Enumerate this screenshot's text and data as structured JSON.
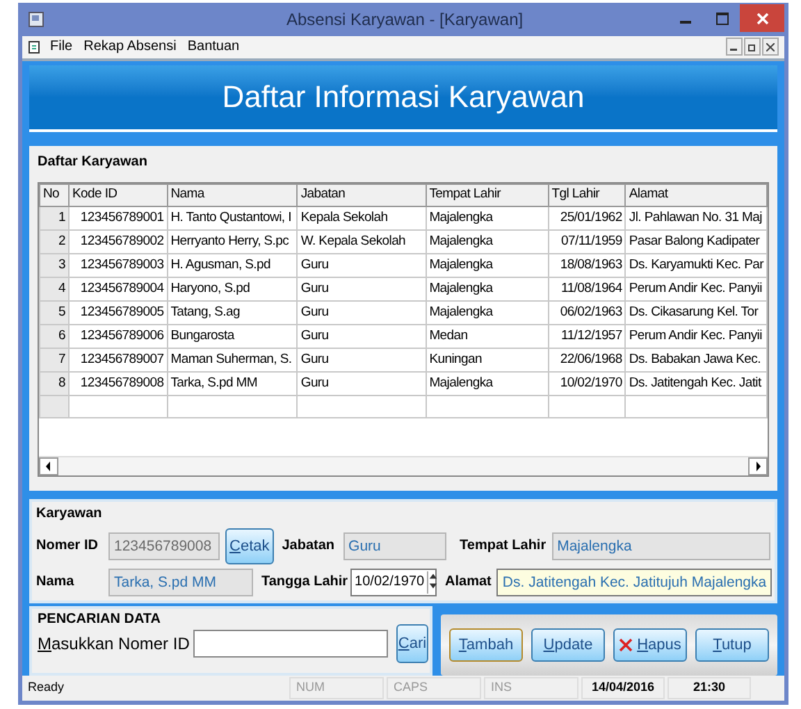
{
  "window": {
    "title": "Absensi Karyawan - [Karyawan]"
  },
  "menu": [
    "File",
    "Rekap Absensi",
    "Bantuan"
  ],
  "header": {
    "title": "Daftar Informasi Karyawan"
  },
  "list_group": {
    "title": "Daftar Karyawan"
  },
  "table": {
    "columns": [
      "No",
      "Kode ID",
      "Nama",
      "Jabatan",
      "Tempat Lahir",
      "Tgl Lahir",
      "Alamat"
    ],
    "rows": [
      [
        "1",
        "123456789001",
        "H. Tanto Qustantowi, I",
        "Kepala Sekolah",
        "Majalengka",
        "25/01/1962",
        "Jl. Pahlawan No. 31 Maj"
      ],
      [
        "2",
        "123456789002",
        "Herryanto Herry, S.pc",
        "W. Kepala Sekolah",
        "Majalengka",
        "07/11/1959",
        "Pasar Balong Kadipater"
      ],
      [
        "3",
        "123456789003",
        "H. Agusman, S.pd",
        "Guru",
        "Majalengka",
        "18/08/1963",
        "Ds. Karyamukti Kec. Par"
      ],
      [
        "4",
        "123456789004",
        "Haryono, S.pd",
        "Guru",
        "Majalengka",
        "11/08/1964",
        "Perum Andir Kec. Panyii"
      ],
      [
        "5",
        "123456789005",
        "Tatang, S.ag",
        "Guru",
        "Majalengka",
        "06/02/1963",
        "Ds. Cikasarung Kel. Tor"
      ],
      [
        "6",
        "123456789006",
        "Bungarosta",
        "Guru",
        "Medan",
        "11/12/1957",
        "Perum Andir Kec. Panyii"
      ],
      [
        "7",
        "123456789007",
        "Maman Suherman, S.",
        "Guru",
        "Kuningan",
        "22/06/1968",
        "Ds. Babakan Jawa Kec."
      ],
      [
        "8",
        "123456789008",
        "Tarka, S.pd MM",
        "Guru",
        "Majalengka",
        "10/02/1970",
        "Ds. Jatitengah Kec. Jatit"
      ]
    ]
  },
  "employee": {
    "title": "Karyawan",
    "fields": [
      {
        "label": "Nomer ID",
        "value": "123456789008",
        "kind": "grey"
      },
      {
        "label": "Jabatan",
        "value": "Guru",
        "kind": "readonly"
      },
      {
        "label": "Tempat Lahir",
        "value": "Majalengka",
        "kind": "readonly"
      },
      {
        "label": "Nama",
        "value": "Tarka, S.pd MM",
        "kind": "readonly"
      },
      {
        "label": "Tangga Lahir",
        "value": "10/02/1970",
        "kind": "date"
      },
      {
        "label": "Alamat",
        "value": "Ds. Jatitengah Kec. Jatitujuh Majalengka",
        "kind": "focused"
      }
    ],
    "print_button": "Cetak"
  },
  "search": {
    "title": "PENCARIAN DATA",
    "label": "Masukkan Nomer ID",
    "button": "Cari"
  },
  "actions": [
    {
      "label": "Tambah",
      "kind": "default"
    },
    {
      "label": "Update",
      "kind": "normal"
    },
    {
      "label": "Hapus",
      "kind": "delete"
    },
    {
      "label": "Tutup",
      "kind": "normal"
    }
  ],
  "status_bar": [
    {
      "text": "Ready",
      "enabled": true
    },
    {
      "text": "NUM",
      "enabled": false
    },
    {
      "text": "CAPS",
      "enabled": false
    },
    {
      "text": "INS",
      "enabled": false
    },
    {
      "text": "14/04/2016",
      "enabled": true
    },
    {
      "text": "21:30",
      "enabled": true
    }
  ]
}
